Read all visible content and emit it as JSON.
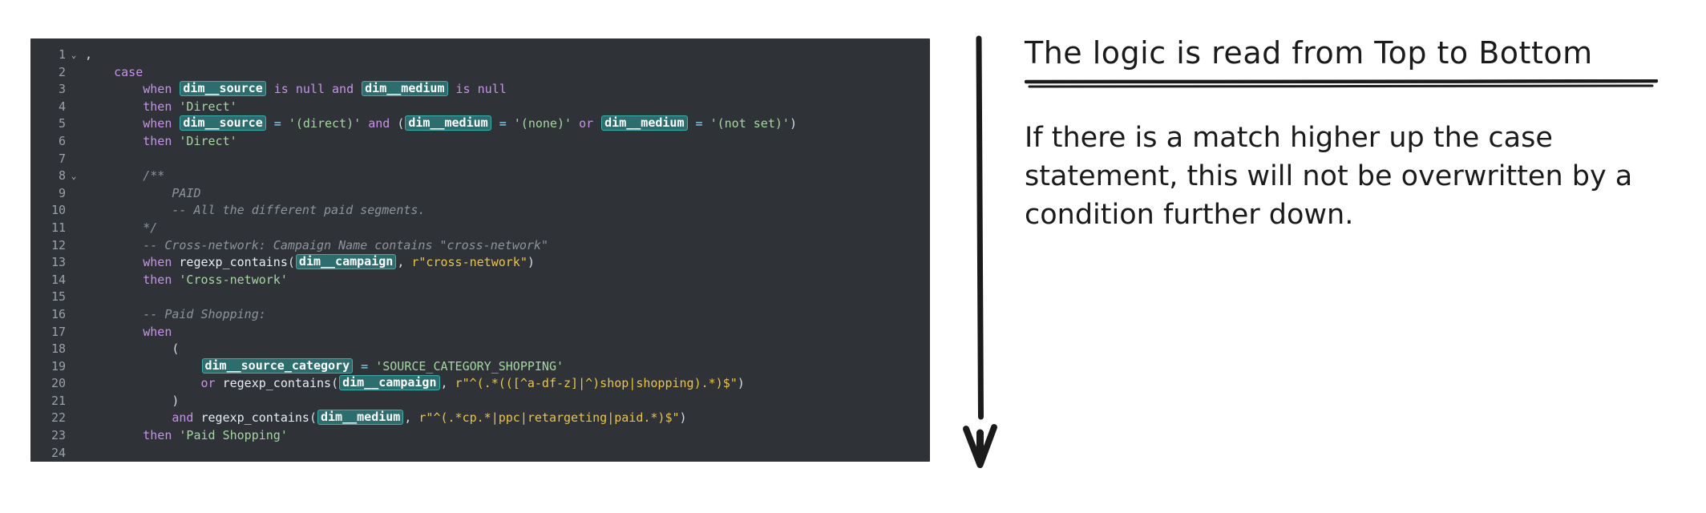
{
  "editor": {
    "language": "sql",
    "theme_background": "#2f3337",
    "gutter_color": "#9aa0a6",
    "accent_pill_bg": "#2c6e6e",
    "accent_pill_border": "#38b0ad",
    "fold_chevron": "⌄",
    "line_numbers": [
      1,
      2,
      3,
      4,
      5,
      6,
      7,
      8,
      9,
      10,
      11,
      12,
      13,
      14,
      15,
      16,
      17,
      18,
      19,
      20,
      21,
      22,
      23,
      24
    ],
    "folded_lines": [
      1,
      8
    ],
    "lines": [
      {
        "n": 1,
        "text": ","
      },
      {
        "n": 2,
        "text": "    case"
      },
      {
        "n": 3,
        "text": "        when dim__source is null and dim__medium is null"
      },
      {
        "n": 4,
        "text": "        then 'Direct'"
      },
      {
        "n": 5,
        "text": "        when dim__source = '(direct)' and (dim__medium = '(none)' or dim__medium = '(not set)')"
      },
      {
        "n": 6,
        "text": "        then 'Direct'"
      },
      {
        "n": 7,
        "text": ""
      },
      {
        "n": 8,
        "text": "        /**"
      },
      {
        "n": 9,
        "text": "            PAID"
      },
      {
        "n": 10,
        "text": "            -- All the different paid segments."
      },
      {
        "n": 11,
        "text": "        */"
      },
      {
        "n": 12,
        "text": "        -- Cross-network: Campaign Name contains \"cross-network\""
      },
      {
        "n": 13,
        "text": "        when regexp_contains(dim__campaign, r\"cross-network\")"
      },
      {
        "n": 14,
        "text": "        then 'Cross-network'"
      },
      {
        "n": 15,
        "text": ""
      },
      {
        "n": 16,
        "text": "        -- Paid Shopping:"
      },
      {
        "n": 17,
        "text": "        when"
      },
      {
        "n": 18,
        "text": "            ("
      },
      {
        "n": 19,
        "text": "                dim__source_category = 'SOURCE_CATEGORY_SHOPPING'"
      },
      {
        "n": 20,
        "text": "                or regexp_contains(dim__campaign, r\"^(.*(([^a-df-z]|^)shop|shopping).*)$\")"
      },
      {
        "n": 21,
        "text": "            )"
      },
      {
        "n": 22,
        "text": "            and regexp_contains(dim__medium, r\"^(.*cp.*|ppc|retargeting|paid.*)$\")"
      },
      {
        "n": 23,
        "text": "        then 'Paid Shopping'"
      },
      {
        "n": 24,
        "text": ""
      }
    ],
    "variables": [
      "dim__source",
      "dim__medium",
      "dim__campaign",
      "dim__source_category"
    ],
    "keywords": [
      "case",
      "when",
      "then",
      "and",
      "or",
      "is",
      "null"
    ],
    "strings": [
      "'Direct'",
      "'(direct)'",
      "'(none)'",
      "'(not set)'",
      "'Cross-network'",
      "'SOURCE_CATEGORY_SHOPPING'",
      "'Paid Shopping'"
    ],
    "regexes": [
      "r\"cross-network\"",
      "r\"^(.*(([^a-df-z]|^)shop|shopping).*)$\"",
      "r\"^(.*cp.*|ppc|retargeting|paid.*)$\""
    ]
  },
  "annotation": {
    "arrow_direction": "down",
    "arrow_color": "#1b1b1b",
    "title": "The logic is read from Top to Bottom",
    "body": "If there is a match higher up the case statement, this will not be overwritten by a condition further down."
  }
}
